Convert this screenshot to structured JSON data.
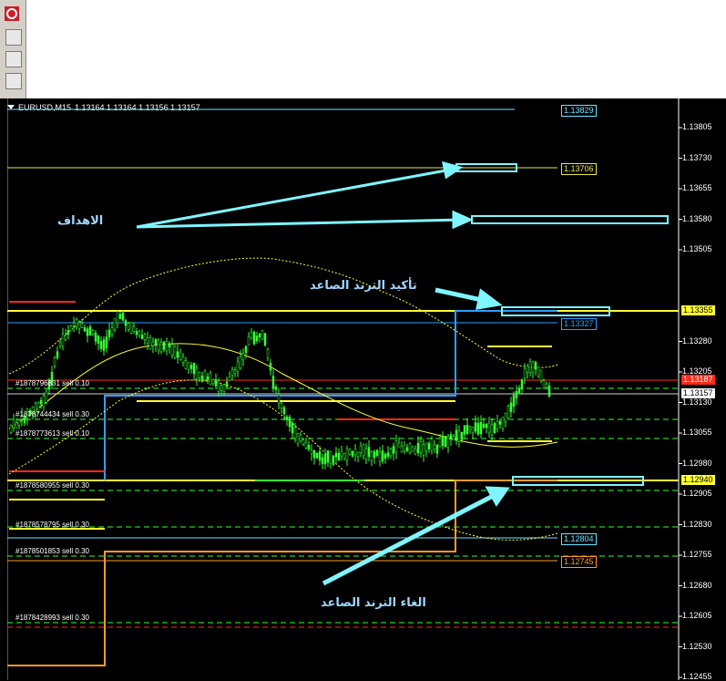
{
  "chart_header": {
    "symbol_label": "EURUSD,M15",
    "ohlc": "1.13164 1.13164 1.13156 1.13157"
  },
  "price_axis": [
    "1.13805",
    "1.13730",
    "1.13655",
    "1.13580",
    "1.13505",
    "1.13280",
    "1.13205",
    "1.13130",
    "1.13055",
    "1.12980",
    "1.12905",
    "1.12830",
    "1.12755",
    "1.12680",
    "1.12605",
    "1.12530",
    "1.12455"
  ],
  "price_tags": {
    "top_partial": "1.13829",
    "target_1": "1.13706",
    "current_high": "1.13355",
    "blue_1": "1.13327",
    "red_level": "1.13187",
    "bid": "1.13157",
    "yellow_low": "1.12940",
    "blue_2": "1.12804",
    "orange": "1.12745"
  },
  "orders": [
    "#1878796831 sell 0.10",
    "#1878744434 sell 0.30",
    "#1878773613 sell 0.10",
    "#1878580955 sell 0.30",
    "#1878578795 sell 0.30",
    "#1878501853 sell 0.30",
    "#1878428993 sell 0.30"
  ],
  "annotations": {
    "targets": "الاهداف",
    "confirm_uptrend": "تأكيد الترند الصاعد",
    "cancel_uptrend": "الغاء الترند الصاعد"
  },
  "colors": {
    "background": "#000000",
    "candles": "#33ff33",
    "yellow_line": "#ffff33",
    "cyan_box": "#7ff5ff",
    "blue_line": "#2ca0ff",
    "red_line": "#ff2a1a",
    "orange_line": "#ff9a2a",
    "annotation_text": "#9fd7ff"
  },
  "icons": {
    "logo": "mt4-logo-icon",
    "toolbar_buttons": [
      "chart-icon",
      "document-icon",
      "window-icon"
    ]
  }
}
